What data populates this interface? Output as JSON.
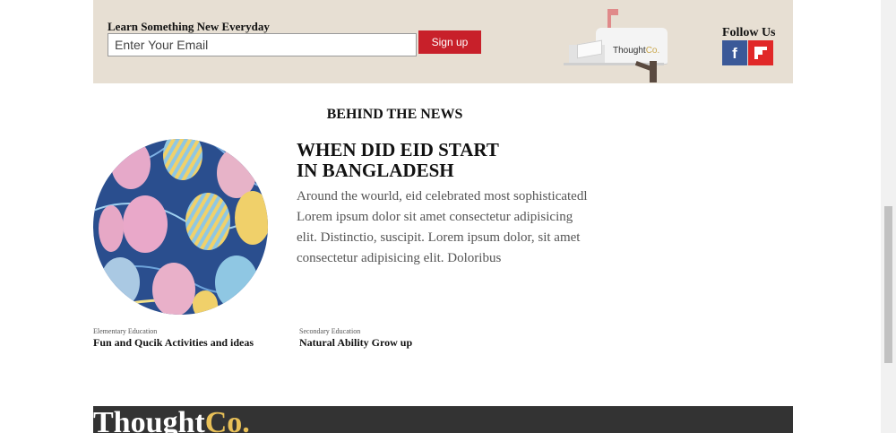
{
  "newsletter": {
    "label": "Learn Something New Everyday",
    "email_placeholder": "Enter Your Email",
    "signup_label": "Sign up",
    "mailbox_logo": {
      "main": "Thought",
      "suffix": "Co."
    }
  },
  "follow": {
    "title": "Follow Us",
    "icons": [
      "facebook-icon",
      "flipboard-icon"
    ]
  },
  "section": {
    "title": "BEHIND THE NEWS"
  },
  "article": {
    "title_line1": "WHEN DID EID START",
    "title_line2": "IN BANGLADESH",
    "body": "Around the wourld, eid celebrated most sophisticatedl Lorem ipsum dolor sit amet consectetur adipisicing elit. Distinctio, suscipit. Lorem ipsum dolor, sit amet consectetur adipisicing elit. Doloribus"
  },
  "cards": [
    {
      "category": "Elementary Education",
      "title": "Fun and Qucik Activities and ideas"
    },
    {
      "category": "Secondary Education",
      "title": "Natural Ability Grow up"
    }
  ],
  "footer": {
    "logo_main": "Thought",
    "logo_suffix": "Co."
  },
  "colors": {
    "newsletter_bg": "#e7dfd3",
    "signup_button": "#c8202a",
    "facebook": "#3b5998",
    "flipboard": "#e12828",
    "footer_bg": "#333333",
    "logo_accent": "#e8c058"
  }
}
